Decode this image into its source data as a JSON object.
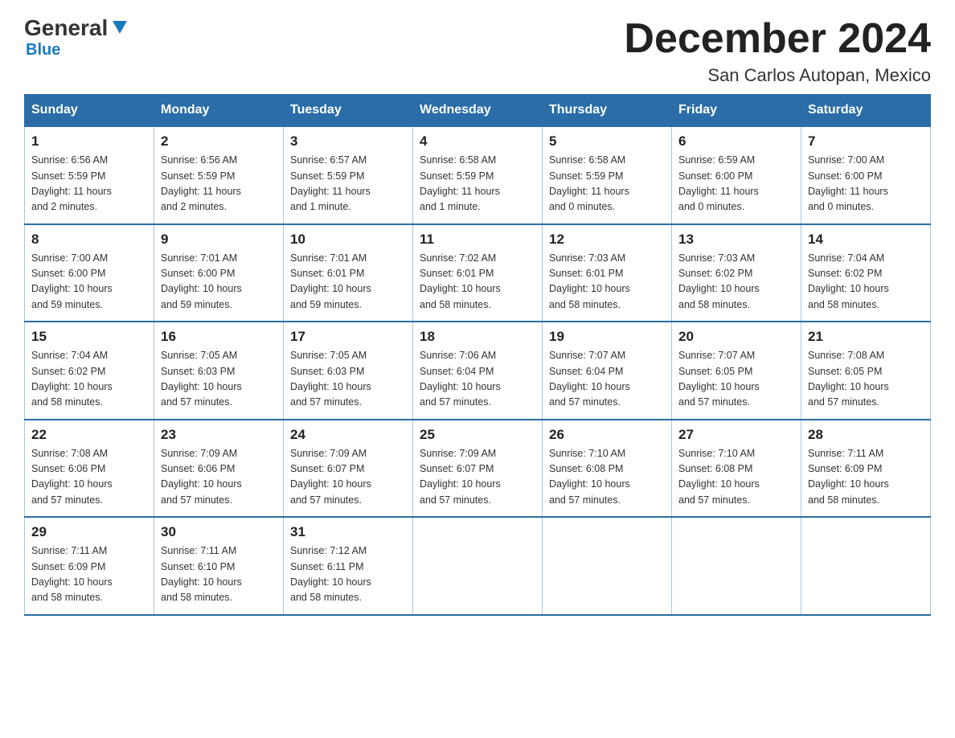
{
  "header": {
    "logo_main": "General",
    "logo_sub": "Blue",
    "title": "December 2024",
    "subtitle": "San Carlos Autopan, Mexico"
  },
  "days_of_week": [
    "Sunday",
    "Monday",
    "Tuesday",
    "Wednesday",
    "Thursday",
    "Friday",
    "Saturday"
  ],
  "weeks": [
    [
      {
        "day": "1",
        "sunrise": "6:56 AM",
        "sunset": "5:59 PM",
        "daylight": "11 hours and 2 minutes."
      },
      {
        "day": "2",
        "sunrise": "6:56 AM",
        "sunset": "5:59 PM",
        "daylight": "11 hours and 2 minutes."
      },
      {
        "day": "3",
        "sunrise": "6:57 AM",
        "sunset": "5:59 PM",
        "daylight": "11 hours and 1 minute."
      },
      {
        "day": "4",
        "sunrise": "6:58 AM",
        "sunset": "5:59 PM",
        "daylight": "11 hours and 1 minute."
      },
      {
        "day": "5",
        "sunrise": "6:58 AM",
        "sunset": "5:59 PM",
        "daylight": "11 hours and 0 minutes."
      },
      {
        "day": "6",
        "sunrise": "6:59 AM",
        "sunset": "6:00 PM",
        "daylight": "11 hours and 0 minutes."
      },
      {
        "day": "7",
        "sunrise": "7:00 AM",
        "sunset": "6:00 PM",
        "daylight": "11 hours and 0 minutes."
      }
    ],
    [
      {
        "day": "8",
        "sunrise": "7:00 AM",
        "sunset": "6:00 PM",
        "daylight": "10 hours and 59 minutes."
      },
      {
        "day": "9",
        "sunrise": "7:01 AM",
        "sunset": "6:00 PM",
        "daylight": "10 hours and 59 minutes."
      },
      {
        "day": "10",
        "sunrise": "7:01 AM",
        "sunset": "6:01 PM",
        "daylight": "10 hours and 59 minutes."
      },
      {
        "day": "11",
        "sunrise": "7:02 AM",
        "sunset": "6:01 PM",
        "daylight": "10 hours and 58 minutes."
      },
      {
        "day": "12",
        "sunrise": "7:03 AM",
        "sunset": "6:01 PM",
        "daylight": "10 hours and 58 minutes."
      },
      {
        "day": "13",
        "sunrise": "7:03 AM",
        "sunset": "6:02 PM",
        "daylight": "10 hours and 58 minutes."
      },
      {
        "day": "14",
        "sunrise": "7:04 AM",
        "sunset": "6:02 PM",
        "daylight": "10 hours and 58 minutes."
      }
    ],
    [
      {
        "day": "15",
        "sunrise": "7:04 AM",
        "sunset": "6:02 PM",
        "daylight": "10 hours and 58 minutes."
      },
      {
        "day": "16",
        "sunrise": "7:05 AM",
        "sunset": "6:03 PM",
        "daylight": "10 hours and 57 minutes."
      },
      {
        "day": "17",
        "sunrise": "7:05 AM",
        "sunset": "6:03 PM",
        "daylight": "10 hours and 57 minutes."
      },
      {
        "day": "18",
        "sunrise": "7:06 AM",
        "sunset": "6:04 PM",
        "daylight": "10 hours and 57 minutes."
      },
      {
        "day": "19",
        "sunrise": "7:07 AM",
        "sunset": "6:04 PM",
        "daylight": "10 hours and 57 minutes."
      },
      {
        "day": "20",
        "sunrise": "7:07 AM",
        "sunset": "6:05 PM",
        "daylight": "10 hours and 57 minutes."
      },
      {
        "day": "21",
        "sunrise": "7:08 AM",
        "sunset": "6:05 PM",
        "daylight": "10 hours and 57 minutes."
      }
    ],
    [
      {
        "day": "22",
        "sunrise": "7:08 AM",
        "sunset": "6:06 PM",
        "daylight": "10 hours and 57 minutes."
      },
      {
        "day": "23",
        "sunrise": "7:09 AM",
        "sunset": "6:06 PM",
        "daylight": "10 hours and 57 minutes."
      },
      {
        "day": "24",
        "sunrise": "7:09 AM",
        "sunset": "6:07 PM",
        "daylight": "10 hours and 57 minutes."
      },
      {
        "day": "25",
        "sunrise": "7:09 AM",
        "sunset": "6:07 PM",
        "daylight": "10 hours and 57 minutes."
      },
      {
        "day": "26",
        "sunrise": "7:10 AM",
        "sunset": "6:08 PM",
        "daylight": "10 hours and 57 minutes."
      },
      {
        "day": "27",
        "sunrise": "7:10 AM",
        "sunset": "6:08 PM",
        "daylight": "10 hours and 57 minutes."
      },
      {
        "day": "28",
        "sunrise": "7:11 AM",
        "sunset": "6:09 PM",
        "daylight": "10 hours and 58 minutes."
      }
    ],
    [
      {
        "day": "29",
        "sunrise": "7:11 AM",
        "sunset": "6:09 PM",
        "daylight": "10 hours and 58 minutes."
      },
      {
        "day": "30",
        "sunrise": "7:11 AM",
        "sunset": "6:10 PM",
        "daylight": "10 hours and 58 minutes."
      },
      {
        "day": "31",
        "sunrise": "7:12 AM",
        "sunset": "6:11 PM",
        "daylight": "10 hours and 58 minutes."
      },
      null,
      null,
      null,
      null
    ]
  ],
  "labels": {
    "sunrise": "Sunrise: ",
    "sunset": "Sunset: ",
    "daylight": "Daylight: "
  }
}
